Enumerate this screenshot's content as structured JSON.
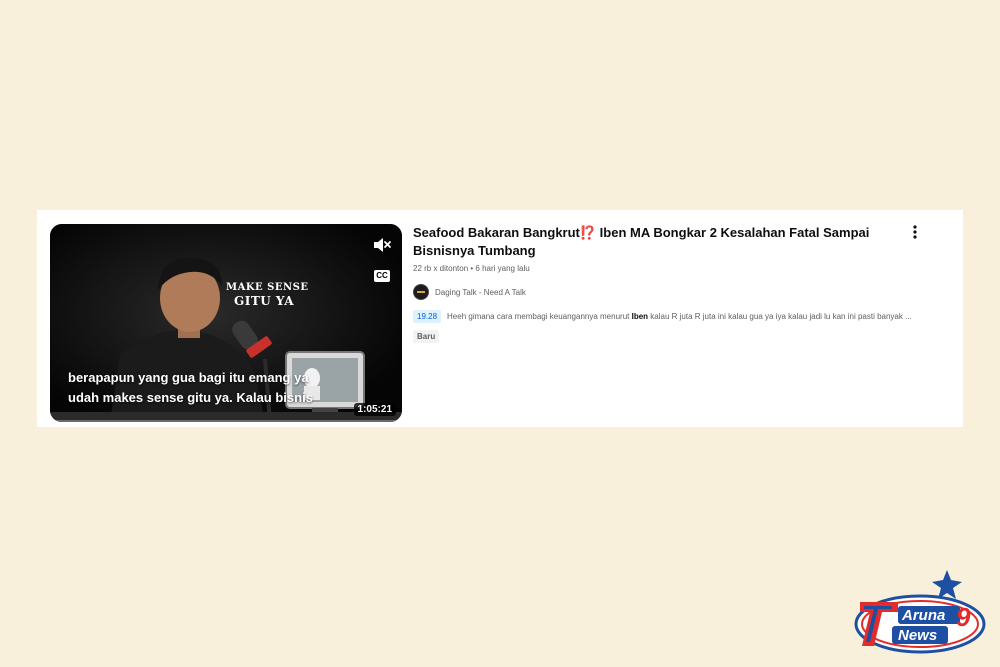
{
  "video": {
    "title": "Seafood Bakaran Bangkrut⁉️ Iben MA Bongkar 2 Kesalahan Fatal Sampai Bisnisnya Tumbang",
    "views": "22 rb x ditonton",
    "age": "6 hari yang lalu",
    "channel": "Daging Talk - Need A Talk",
    "chapter_time": "19.28",
    "snippet_before": "Heeh gimana cara membagi keuangannya menurut ",
    "snippet_bold": "Iben",
    "snippet_after": " kalau R juta R juta ini kalau gua ya iya kalau jadi lu kan ini pasti banyak ...",
    "badge": "Baru",
    "duration": "1:05:21",
    "progress_fraction": 0.0
  },
  "thumbnail": {
    "overlay_line1": "MAKE SENSE",
    "overlay_line2": "GITU YA",
    "caption_line1": "berapapun yang gua bagi itu emang ya",
    "caption_line2": "udah makes sense gitu ya. Kalau bisnis",
    "cc_label": "CC"
  },
  "watermark": {
    "line1": "Aruna",
    "line2": "News",
    "number": "9"
  },
  "colors": {
    "background": "#f9f0db",
    "card": "#ffffff",
    "title_text": "#0f0f0f",
    "meta_text": "#606060",
    "chapter_bg": "#def1ff",
    "chapter_text": "#065fd4",
    "logo_red": "#e32b2b",
    "logo_blue": "#1d4fa3"
  }
}
